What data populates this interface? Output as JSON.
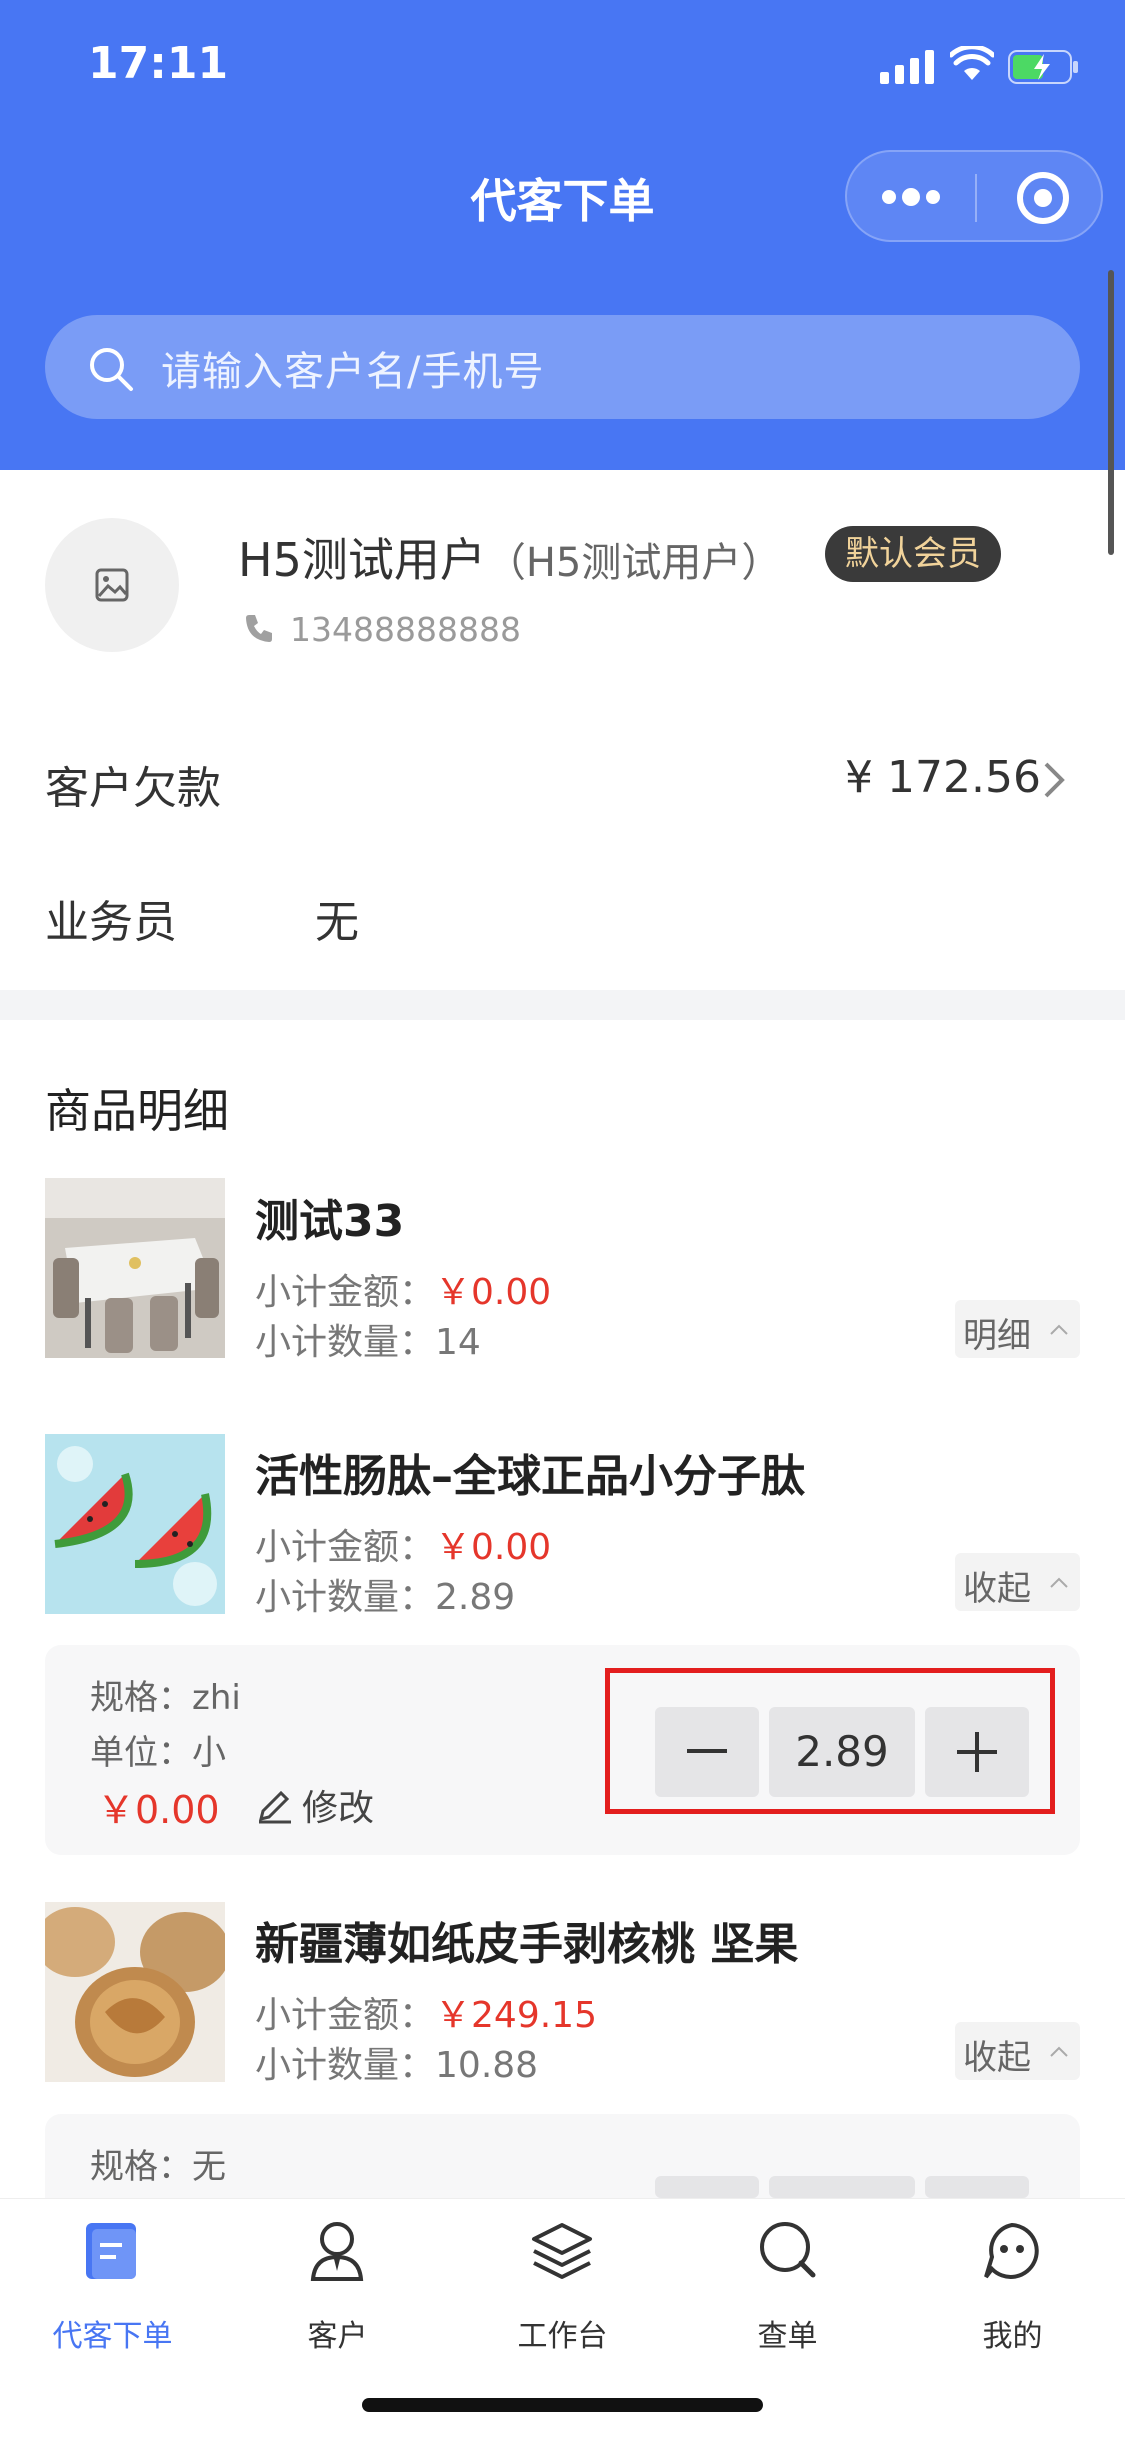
{
  "status": {
    "time": "17:11"
  },
  "header": {
    "title": "代客下单",
    "search_placeholder": "请输入客户名/手机号"
  },
  "customer": {
    "name": "H5测试用户",
    "alias": "（H5测试用户）",
    "badge": "默认会员",
    "phone": "13488888888",
    "debt_label": "客户欠款",
    "debt_value": "¥ 172.56",
    "sales_label": "业务员",
    "sales_value": "无"
  },
  "section_title": "商品明细",
  "products": [
    {
      "name": "测试33",
      "amount_label": "小计金额：",
      "amount": "￥0.00",
      "qty_label": "小计数量：",
      "qty": "14",
      "toggle": "明细",
      "image": "dining-table-photo"
    },
    {
      "name": "活性肠肽–全球正品小分子肽",
      "amount_label": "小计金额：",
      "amount": "￥0.00",
      "qty_label": "小计数量：",
      "qty": "2.89",
      "toggle": "收起",
      "image": "watermelon-photo",
      "detail": {
        "spec": "规格：zhi",
        "unit": "单位：小",
        "price": "￥0.00",
        "edit": "修改",
        "stepper_value": "2.89"
      }
    },
    {
      "name": "新疆薄如纸皮手剥核桃 坚果",
      "amount_label": "小计金额：",
      "amount": "￥249.15",
      "qty_label": "小计数量：",
      "qty": "10.88",
      "toggle": "收起",
      "image": "walnut-photo",
      "detail": {
        "spec": "规格：无"
      }
    }
  ],
  "tabbar": [
    {
      "label": "代客下单",
      "icon": "order-icon"
    },
    {
      "label": "客户",
      "icon": "user-icon"
    },
    {
      "label": "工作台",
      "icon": "layers-icon"
    },
    {
      "label": "查单",
      "icon": "search-icon"
    },
    {
      "label": "我的",
      "icon": "profile-face-icon"
    }
  ],
  "colors": {
    "brand": "#4876f3",
    "price_red": "#e5362b",
    "highlight_box": "#e31e1e"
  }
}
